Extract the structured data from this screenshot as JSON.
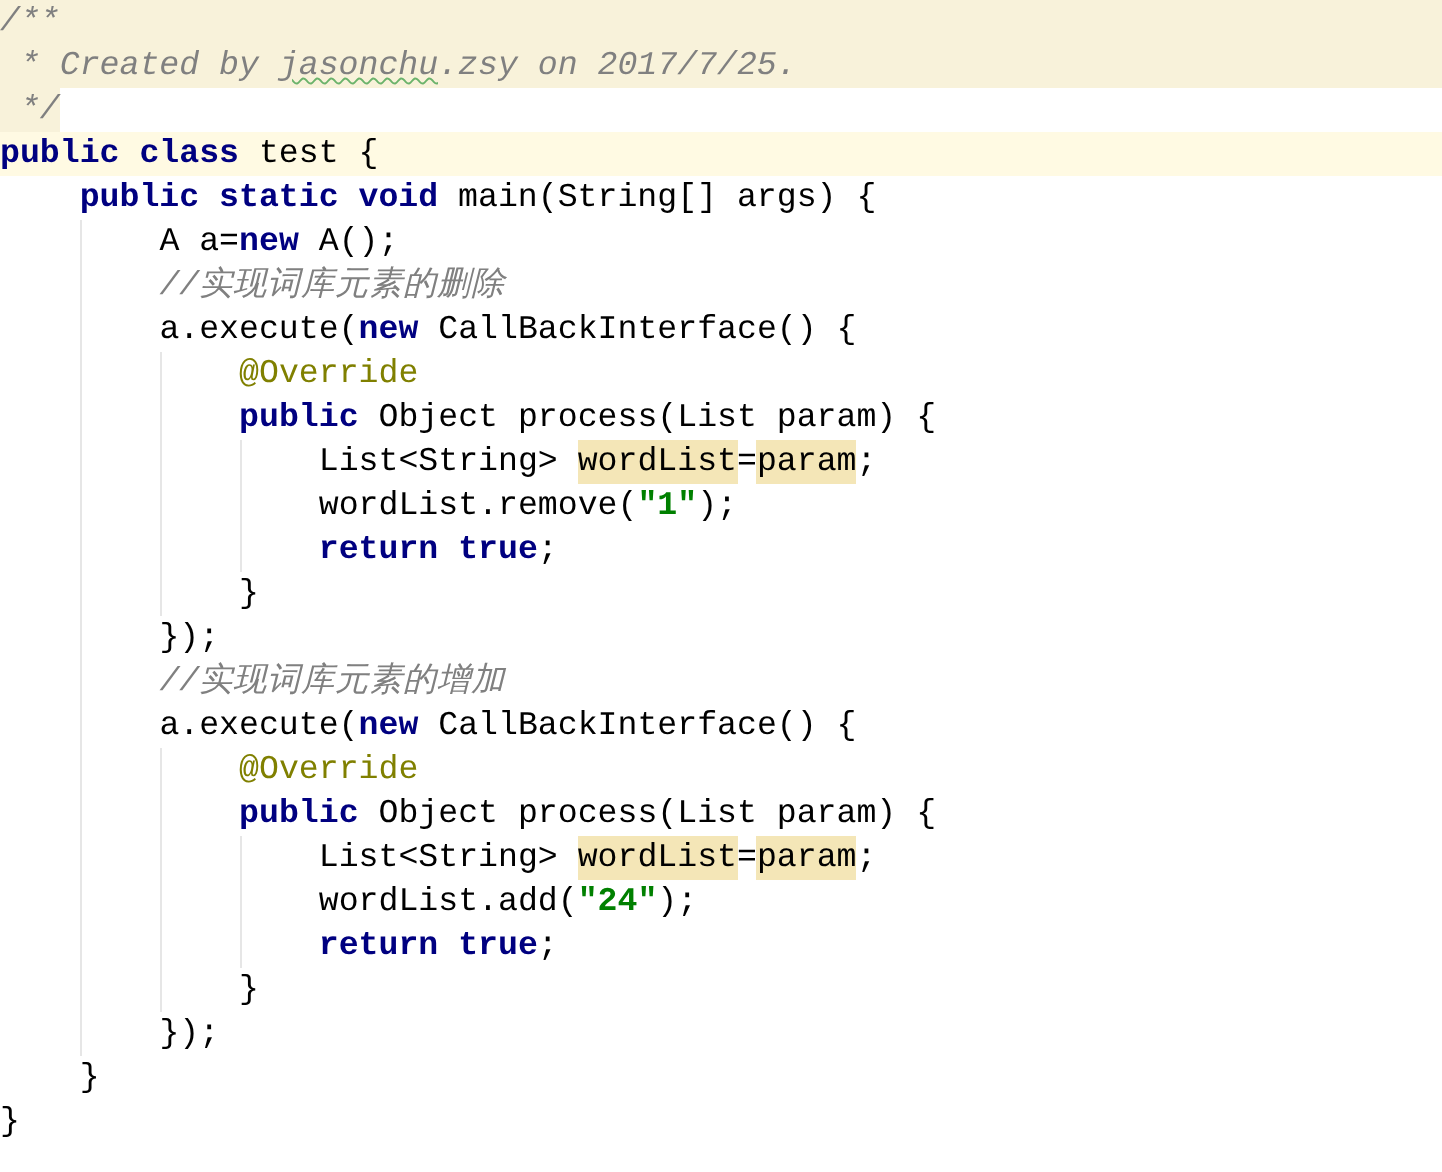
{
  "editor": {
    "lines": [
      {
        "kind": "doc",
        "current": false,
        "segments": [
          {
            "text": "/**",
            "kind": "doc"
          }
        ]
      },
      {
        "kind": "doc",
        "current": false,
        "segments": [
          {
            "text": " * Created by ",
            "kind": "doc"
          },
          {
            "text": "jasonchu",
            "kind": "typo"
          },
          {
            "text": ".zsy on 2017/7/25.",
            "kind": "doc"
          }
        ]
      },
      {
        "kind": "code",
        "current": false,
        "segments": [
          {
            "text": " */",
            "kind": "doc"
          }
        ]
      },
      {
        "kind": "code",
        "current": true,
        "segments": [
          {
            "text": "public class",
            "kind": "keyword"
          },
          {
            "text": " test {",
            "kind": "plain"
          }
        ]
      },
      {
        "kind": "code",
        "current": false,
        "segments": [
          {
            "text": "    public static void",
            "kind": "keyword"
          },
          {
            "text": " main(String[] args) {",
            "kind": "plain"
          }
        ]
      },
      {
        "kind": "code",
        "current": false,
        "segments": [
          {
            "text": "        A a=",
            "kind": "plain"
          },
          {
            "text": "new",
            "kind": "keyword"
          },
          {
            "text": " A();",
            "kind": "plain"
          }
        ]
      },
      {
        "kind": "code",
        "current": false,
        "segments": [
          {
            "text": "        //实现词库元素的删除",
            "kind": "comment"
          }
        ]
      },
      {
        "kind": "code",
        "current": false,
        "segments": [
          {
            "text": "        a.execute(",
            "kind": "plain"
          },
          {
            "text": "new",
            "kind": "keyword"
          },
          {
            "text": " CallBackInterface() {",
            "kind": "plain"
          }
        ]
      },
      {
        "kind": "code",
        "current": false,
        "segments": [
          {
            "text": "            @Override",
            "kind": "annotation"
          }
        ]
      },
      {
        "kind": "code",
        "current": false,
        "segments": [
          {
            "text": "            public",
            "kind": "keyword"
          },
          {
            "text": " Object process(List param) {",
            "kind": "plain"
          }
        ]
      },
      {
        "kind": "code",
        "current": false,
        "segments": [
          {
            "text": "                List<String> ",
            "kind": "plain"
          },
          {
            "text": "wordList",
            "kind": "usage"
          },
          {
            "text": "=",
            "kind": "plain"
          },
          {
            "text": "param",
            "kind": "usage"
          },
          {
            "text": ";",
            "kind": "plain"
          }
        ]
      },
      {
        "kind": "code",
        "current": false,
        "segments": [
          {
            "text": "                wordList.remove(",
            "kind": "plain"
          },
          {
            "text": "\"1\"",
            "kind": "string"
          },
          {
            "text": ");",
            "kind": "plain"
          }
        ]
      },
      {
        "kind": "code",
        "current": false,
        "segments": [
          {
            "text": "                return true",
            "kind": "keyword"
          },
          {
            "text": ";",
            "kind": "plain"
          }
        ]
      },
      {
        "kind": "code",
        "current": false,
        "segments": [
          {
            "text": "            }",
            "kind": "plain"
          }
        ]
      },
      {
        "kind": "code",
        "current": false,
        "segments": [
          {
            "text": "        });",
            "kind": "plain"
          }
        ]
      },
      {
        "kind": "code",
        "current": false,
        "segments": [
          {
            "text": "        //实现词库元素的增加",
            "kind": "comment"
          }
        ]
      },
      {
        "kind": "code",
        "current": false,
        "segments": [
          {
            "text": "        a.execute(",
            "kind": "plain"
          },
          {
            "text": "new",
            "kind": "keyword"
          },
          {
            "text": " CallBackInterface() {",
            "kind": "plain"
          }
        ]
      },
      {
        "kind": "code",
        "current": false,
        "segments": [
          {
            "text": "            @Override",
            "kind": "annotation"
          }
        ]
      },
      {
        "kind": "code",
        "current": false,
        "segments": [
          {
            "text": "            public",
            "kind": "keyword"
          },
          {
            "text": " Object process(List param) {",
            "kind": "plain"
          }
        ]
      },
      {
        "kind": "code",
        "current": false,
        "segments": [
          {
            "text": "                List<String> ",
            "kind": "plain"
          },
          {
            "text": "wordList",
            "kind": "usage"
          },
          {
            "text": "=",
            "kind": "plain"
          },
          {
            "text": "param",
            "kind": "usage"
          },
          {
            "text": ";",
            "kind": "plain"
          }
        ]
      },
      {
        "kind": "code",
        "current": false,
        "segments": [
          {
            "text": "                wordList.add(",
            "kind": "plain"
          },
          {
            "text": "\"24\"",
            "kind": "string"
          },
          {
            "text": ");",
            "kind": "plain"
          }
        ]
      },
      {
        "kind": "code",
        "current": false,
        "segments": [
          {
            "text": "                return true",
            "kind": "keyword"
          },
          {
            "text": ";",
            "kind": "plain"
          }
        ]
      },
      {
        "kind": "code",
        "current": false,
        "segments": [
          {
            "text": "            }",
            "kind": "plain"
          }
        ]
      },
      {
        "kind": "code",
        "current": false,
        "segments": [
          {
            "text": "        });",
            "kind": "plain"
          }
        ]
      },
      {
        "kind": "code",
        "current": false,
        "segments": [
          {
            "text": "    }",
            "kind": "plain"
          }
        ]
      },
      {
        "kind": "code",
        "current": false,
        "segments": [
          {
            "text": "}",
            "kind": "plain"
          }
        ]
      }
    ]
  }
}
